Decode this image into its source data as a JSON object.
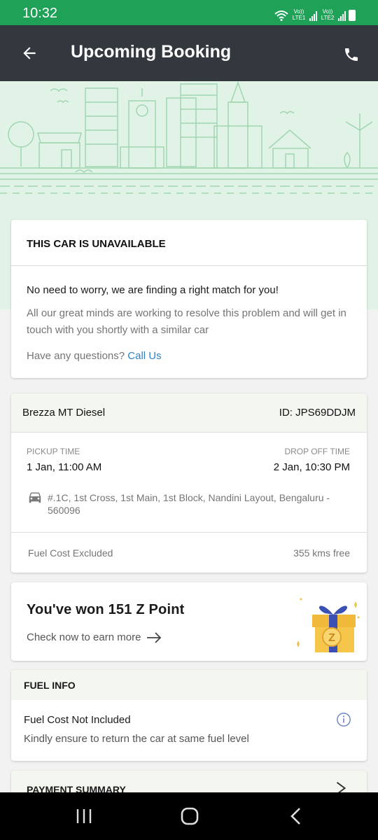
{
  "status_bar": {
    "time": "10:32",
    "sim1_label": "Vo)) LTE1",
    "sim2_label": "Vo)) LTE2",
    "icons": [
      "wifi-icon",
      "signal-icon",
      "signal-icon",
      "battery-icon"
    ]
  },
  "app_bar": {
    "title": "Upcoming Booking",
    "back_icon": "arrow-back-icon",
    "call_icon": "phone-icon"
  },
  "unavailable_card": {
    "heading": "THIS CAR IS UNAVAILABLE",
    "message": "No need to worry, we are finding a right match for you!",
    "details": "All our great minds are working to resolve this problem and will get in touch with you shortly with a similar car",
    "question": "Have any questions?",
    "call_link": "Call Us"
  },
  "booking": {
    "car_name": "Brezza MT Diesel",
    "booking_id": "ID: JPS69DDJM",
    "pickup_label": "PICKUP TIME",
    "pickup_value": "1 Jan, 11:00 AM",
    "dropoff_label": "DROP OFF TIME",
    "dropoff_value": "2 Jan, 10:30 PM",
    "address": "#.1C, 1st Cross, 1st Main, 1st Block, Nandini Layout, Bengaluru - 560096",
    "fuel_cost": "Fuel Cost Excluded",
    "kms_free": "355 kms free"
  },
  "points_card": {
    "title": "You've won 151 Z Point",
    "link": "Check now to earn more",
    "gift_letter": "Z"
  },
  "fuel_info": {
    "heading": "FUEL INFO",
    "title": "Fuel Cost Not Included",
    "subtitle": "Kindly ensure to return the car at same fuel level"
  },
  "payment": {
    "heading": "PAYMENT SUMMARY"
  },
  "colors": {
    "status_bar": "#1fa157",
    "app_bar": "#33383f",
    "hero_bg": "#e0f3e6",
    "link": "#2d83c8",
    "card_header": "#f4f6f0"
  }
}
